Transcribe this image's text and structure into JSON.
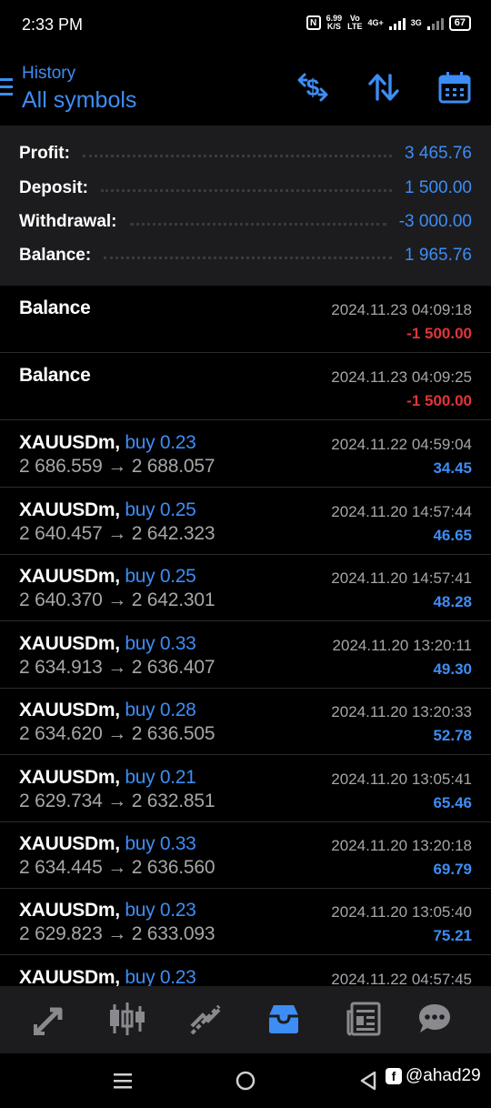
{
  "status_bar": {
    "time": "2:33 PM",
    "nfc": "N",
    "speed_value": "6.99",
    "speed_unit": "K/S",
    "volte_top": "Vo",
    "volte_bottom": "LTE",
    "net1": "4G+",
    "net2": "3G",
    "battery": "67"
  },
  "header": {
    "subtitle": "History",
    "title": "All symbols"
  },
  "summary": [
    {
      "label": "Profit:",
      "value": "3 465.76"
    },
    {
      "label": "Deposit:",
      "value": "1 500.00"
    },
    {
      "label": "Withdrawal:",
      "value": "-3 000.00"
    },
    {
      "label": "Balance:",
      "value": "1 965.76"
    }
  ],
  "deals": [
    {
      "symbol": "Balance",
      "type": "",
      "prices": "",
      "time": "2024.11.23 04:09:18",
      "profit": "-1 500.00",
      "sign": "neg"
    },
    {
      "symbol": "Balance",
      "type": "",
      "prices": "",
      "time": "2024.11.23 04:09:25",
      "profit": "-1 500.00",
      "sign": "neg"
    },
    {
      "symbol": "XAUUSDm,",
      "type": "buy 0.23",
      "prices": "2 686.559 → 2 688.057",
      "time": "2024.11.22 04:59:04",
      "profit": "34.45",
      "sign": "pos"
    },
    {
      "symbol": "XAUUSDm,",
      "type": "buy 0.25",
      "prices": "2 640.457 → 2 642.323",
      "time": "2024.11.20 14:57:44",
      "profit": "46.65",
      "sign": "pos"
    },
    {
      "symbol": "XAUUSDm,",
      "type": "buy 0.25",
      "prices": "2 640.370 → 2 642.301",
      "time": "2024.11.20 14:57:41",
      "profit": "48.28",
      "sign": "pos"
    },
    {
      "symbol": "XAUUSDm,",
      "type": "buy 0.33",
      "prices": "2 634.913 → 2 636.407",
      "time": "2024.11.20 13:20:11",
      "profit": "49.30",
      "sign": "pos"
    },
    {
      "symbol": "XAUUSDm,",
      "type": "buy 0.28",
      "prices": "2 634.620 → 2 636.505",
      "time": "2024.11.20 13:20:33",
      "profit": "52.78",
      "sign": "pos"
    },
    {
      "symbol": "XAUUSDm,",
      "type": "buy 0.21",
      "prices": "2 629.734 → 2 632.851",
      "time": "2024.11.20 13:05:41",
      "profit": "65.46",
      "sign": "pos"
    },
    {
      "symbol": "XAUUSDm,",
      "type": "buy 0.33",
      "prices": "2 634.445 → 2 636.560",
      "time": "2024.11.20 13:20:18",
      "profit": "69.79",
      "sign": "pos"
    },
    {
      "symbol": "XAUUSDm,",
      "type": "buy 0.23",
      "prices": "2 629.823 → 2 633.093",
      "time": "2024.11.20 13:05:40",
      "profit": "75.21",
      "sign": "pos"
    },
    {
      "symbol": "XAUUSDm,",
      "type": "buy 0.23",
      "prices": "",
      "time": "2024.11.22 04:57:45",
      "profit": "",
      "sign": "pos"
    }
  ],
  "bottom_nav": [
    {
      "name": "nav-quotes",
      "icon": "arrows-diagonal-icon",
      "active": false
    },
    {
      "name": "nav-chart",
      "icon": "candlestick-icon",
      "active": false
    },
    {
      "name": "nav-trade",
      "icon": "trend-line-icon",
      "active": false
    },
    {
      "name": "nav-history",
      "icon": "inbox-icon",
      "active": true
    },
    {
      "name": "nav-news",
      "icon": "newspaper-icon",
      "active": false
    },
    {
      "name": "nav-messages",
      "icon": "chat-bubble-icon",
      "active": false
    }
  ],
  "watermark": {
    "badge": "f",
    "handle": "@ahad29"
  },
  "colors": {
    "accent": "#3d8df5",
    "negative": "#e0343b",
    "muted": "#a6a6aa",
    "panel": "#1c1c1e"
  }
}
